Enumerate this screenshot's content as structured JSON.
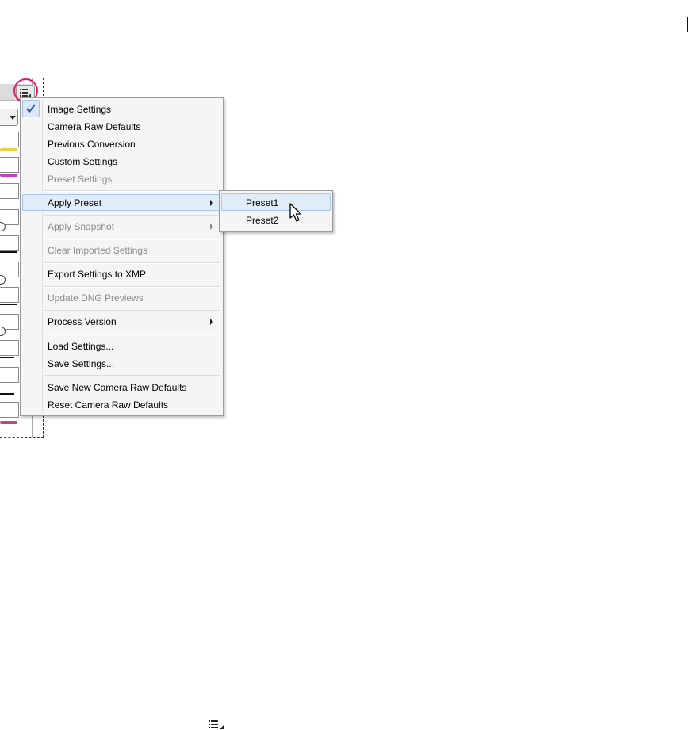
{
  "menu": {
    "items": [
      {
        "label": "Image Settings",
        "checked": true,
        "disabled": false
      },
      {
        "label": "Camera Raw Defaults",
        "disabled": false
      },
      {
        "label": "Previous Conversion",
        "disabled": false
      },
      {
        "label": "Custom Settings",
        "disabled": false
      },
      {
        "label": "Preset Settings",
        "disabled": true
      },
      {
        "label": "Apply Preset",
        "disabled": false,
        "submenu": true,
        "highlighted": true
      },
      {
        "label": "Apply Snapshot",
        "disabled": true,
        "submenu": true
      },
      {
        "label": "Clear Imported Settings",
        "disabled": true
      },
      {
        "label": "Export Settings to XMP",
        "disabled": false
      },
      {
        "label": "Update DNG Previews",
        "disabled": true
      },
      {
        "label": "Process Version",
        "disabled": false,
        "submenu": true
      },
      {
        "label": "Load Settings...",
        "disabled": false
      },
      {
        "label": "Save Settings...",
        "disabled": false
      },
      {
        "label": "Save New Camera Raw Defaults",
        "disabled": false
      },
      {
        "label": "Reset Camera Raw Defaults",
        "disabled": false
      }
    ]
  },
  "submenu": {
    "items": [
      {
        "label": "Preset1",
        "highlighted": true
      },
      {
        "label": "Preset2"
      }
    ]
  },
  "colors": {
    "highlight_circle": "#e2186b",
    "hover_bg": "#e1ecf9",
    "disabled_text": "#8c8c8c"
  },
  "icons": {
    "menu_button": "list-menu-icon",
    "checkmark": "checkmark-icon",
    "cursor": "mouse-pointer-icon"
  }
}
